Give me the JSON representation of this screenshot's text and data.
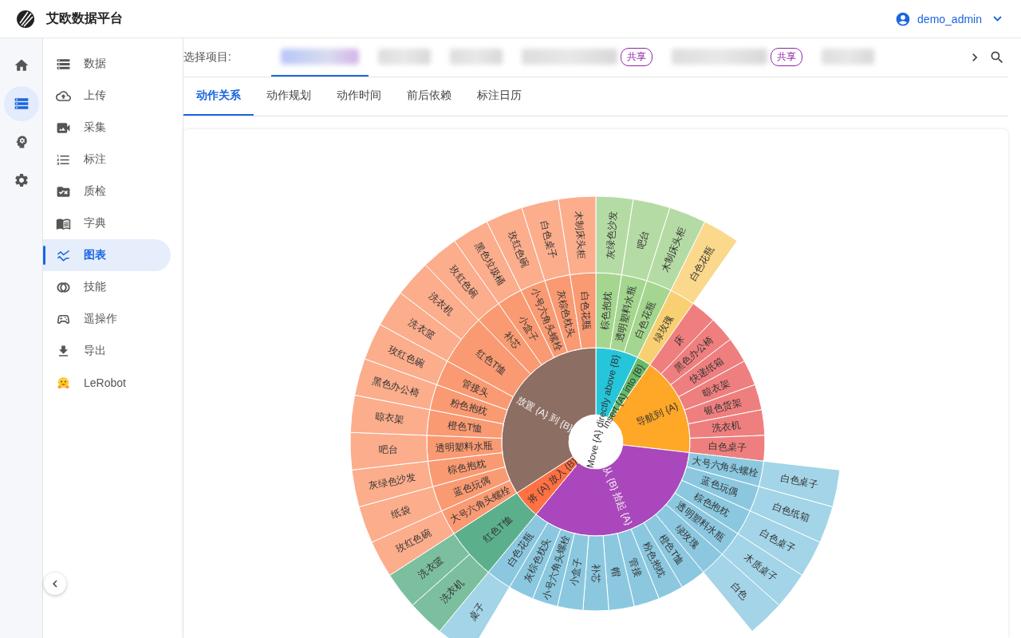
{
  "header": {
    "title": "艾欧数据平台",
    "user": "demo_admin"
  },
  "rail": [
    {
      "kind": "home",
      "selected": false
    },
    {
      "kind": "data",
      "selected": true
    },
    {
      "kind": "skill",
      "selected": false
    },
    {
      "kind": "settings",
      "selected": false
    }
  ],
  "menu": [
    {
      "kind": "data",
      "label": "数据",
      "selected": false
    },
    {
      "kind": "upload",
      "label": "上传",
      "selected": false
    },
    {
      "kind": "capture",
      "label": "采集",
      "selected": false
    },
    {
      "kind": "annotate",
      "label": "标注",
      "selected": false
    },
    {
      "kind": "qc",
      "label": "质检",
      "selected": false
    },
    {
      "kind": "dict",
      "label": "字典",
      "selected": false
    },
    {
      "kind": "chart",
      "label": "图表",
      "selected": true
    },
    {
      "kind": "skills",
      "label": "技能",
      "selected": false
    },
    {
      "kind": "teleop",
      "label": "遥操作",
      "selected": false
    },
    {
      "kind": "export",
      "label": "导出",
      "selected": false
    },
    {
      "kind": "hug",
      "label": "LeRobot",
      "selected": false
    }
  ],
  "project_bar": {
    "label": "选择项目:",
    "projects": [
      {
        "selected": true,
        "kind": "tinted"
      },
      {
        "selected": false,
        "kind": "plain"
      },
      {
        "selected": false,
        "kind": "plain"
      },
      {
        "selected": false,
        "kind": "plain",
        "badge": "共享"
      },
      {
        "selected": false,
        "kind": "plain",
        "badge": "共享"
      },
      {
        "selected": false,
        "kind": "plain"
      }
    ]
  },
  "tabs": [
    {
      "label": "动作关系",
      "selected": true
    },
    {
      "label": "动作规划",
      "selected": false
    },
    {
      "label": "动作时间",
      "selected": false
    },
    {
      "label": "前后依赖",
      "selected": false
    },
    {
      "label": "标注日历",
      "selected": false
    }
  ],
  "sunburst": {
    "nodes": [
      {
        "label": "Move {A} directly above {B}",
        "color": "#26c6da",
        "children": [
          {
            "label": "棕色抱枕",
            "color": "#a5d68f",
            "children": [
              {
                "label": "灰绿色沙发",
                "color": "#b5dba4"
              }
            ]
          },
          {
            "label": "透明塑料水瓶",
            "color": "#a5d68f",
            "children": [
              {
                "label": "吧台",
                "color": "#b5dba4"
              }
            ]
          },
          {
            "label": "白色花瓶",
            "color": "#a5d68f",
            "children": [
              {
                "label": "木制床头柜",
                "color": "#b5dba4"
              }
            ]
          }
        ]
      },
      {
        "label": "Insert {A} into {B}",
        "color": "#66bb6a",
        "children": [
          {
            "label": "绿玫瑰",
            "color": "#f9d071",
            "children": [
              {
                "label": "白色花瓶",
                "color": "#fad88c"
              }
            ]
          }
        ]
      },
      {
        "label": "导航到 {A}",
        "color": "#ffa726",
        "children": [
          {
            "label": "床",
            "color": "#ef7f7f"
          },
          {
            "label": "黑色办公椅",
            "color": "#ef7f7f"
          },
          {
            "label": "快递纸箱",
            "color": "#ef7f7f"
          },
          {
            "label": "晾衣架",
            "color": "#ef7f7f"
          },
          {
            "label": "银色货架",
            "color": "#ef7f7f"
          },
          {
            "label": "洗衣机",
            "color": "#ef7f7f"
          },
          {
            "label": "白色桌子",
            "color": "#ef7f7f"
          }
        ]
      },
      {
        "label": "从 {B} 拾起 {A}",
        "color": "#ab47bc",
        "children": [
          {
            "label": "大号六角头螺栓",
            "color": "#8bc8e0",
            "children": [
              {
                "label": "白色桌子",
                "color": "#a3d4e7"
              }
            ]
          },
          {
            "label": "蓝色玩偶",
            "color": "#8bc8e0",
            "children": [
              {
                "label": "白色纸箱",
                "color": "#a3d4e7"
              }
            ]
          },
          {
            "label": "棕色抱枕",
            "color": "#8bc8e0",
            "children": [
              {
                "label": "白色桌子",
                "color": "#a3d4e7"
              }
            ]
          },
          {
            "label": "透明塑料水瓶",
            "color": "#8bc8e0",
            "children": [
              {
                "label": "木质桌子",
                "color": "#a3d4e7"
              }
            ]
          },
          {
            "label": "绿玫瑰",
            "color": "#8bc8e0",
            "children": [
              {
                "label": "白色",
                "color": "#a3d4e7"
              }
            ]
          },
          {
            "label": "橙色T恤",
            "color": "#8bc8e0"
          },
          {
            "label": "粉色抱枕",
            "color": "#8bc8e0"
          },
          {
            "label": "管接",
            "color": "#8bc8e0"
          },
          {
            "label": "帽",
            "color": "#8bc8e0"
          },
          {
            "label": "补芯",
            "color": "#8bc8e0"
          },
          {
            "label": "小盒子",
            "color": "#8bc8e0"
          },
          {
            "label": "小号六角头螺栓",
            "color": "#8bc8e0"
          },
          {
            "label": "灰棕色枕头",
            "color": "#8bc8e0"
          },
          {
            "label": "白色花瓶",
            "color": "#8bc8e0",
            "children": [
              {
                "label": "桌子",
                "color": "#a3d4e7"
              }
            ]
          }
        ]
      },
      {
        "label": "将 {A} 放入 {B}",
        "color": "#ff7043",
        "children": [
          {
            "label": "红色T恤",
            "color": "#5bb08b",
            "children": [
              {
                "label": "洗衣机",
                "color": "#7cbf9f"
              },
              {
                "label": "洗衣篮",
                "color": "#7cbf9f"
              }
            ]
          }
        ]
      },
      {
        "label": "放置 {A} 到 {B}",
        "color": "#8d6e63",
        "children": [
          {
            "label": "大号六角头螺栓",
            "color": "#f99a72",
            "children": [
              {
                "label": "玫红色碗",
                "color": "#fbad8c"
              }
            ]
          },
          {
            "label": "蓝色玩偶",
            "color": "#f99a72",
            "children": [
              {
                "label": "纸袋",
                "color": "#fbad8c"
              }
            ]
          },
          {
            "label": "棕色抱枕",
            "color": "#f99a72",
            "children": [
              {
                "label": "灰绿色沙发",
                "color": "#fbad8c"
              }
            ]
          },
          {
            "label": "透明塑料水瓶",
            "color": "#f99a72",
            "children": [
              {
                "label": "吧台",
                "color": "#fbad8c"
              }
            ]
          },
          {
            "label": "橙色T恤",
            "color": "#f99a72",
            "children": [
              {
                "label": "晾衣架",
                "color": "#fbad8c"
              }
            ]
          },
          {
            "label": "粉色抱枕",
            "color": "#f99a72",
            "children": [
              {
                "label": "黑色办公椅",
                "color": "#fbad8c"
              }
            ]
          },
          {
            "label": "管接头",
            "color": "#f99a72",
            "children": [
              {
                "label": "玫红色碗",
                "color": "#fbad8c"
              }
            ]
          },
          {
            "label": "红色T恤",
            "color": "#f99a72",
            "children": [
              {
                "label": "洗衣篮",
                "color": "#fbad8c"
              },
              {
                "label": "洗衣机",
                "color": "#fbad8c"
              }
            ]
          },
          {
            "label": "补芯",
            "color": "#f99a72",
            "children": [
              {
                "label": "玫红色碗",
                "color": "#fbad8c"
              }
            ]
          },
          {
            "label": "小盒子",
            "color": "#f99a72",
            "children": [
              {
                "label": "黑色垃圾桶",
                "color": "#fbad8c"
              }
            ]
          },
          {
            "label": "小号六角头螺栓",
            "color": "#f99a72",
            "children": [
              {
                "label": "玫红色碗",
                "color": "#fbad8c"
              }
            ]
          },
          {
            "label": "灰棕色枕头",
            "color": "#f99a72",
            "children": [
              {
                "label": "白色桌子",
                "color": "#fbad8c"
              }
            ]
          },
          {
            "label": "白色花瓶",
            "color": "#f99a72",
            "children": [
              {
                "label": "木制床头柜",
                "color": "#fbad8c"
              }
            ]
          }
        ]
      }
    ]
  }
}
